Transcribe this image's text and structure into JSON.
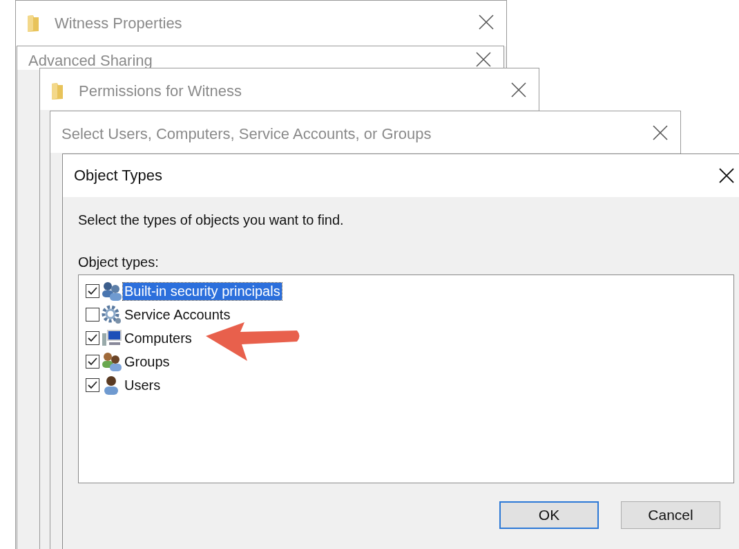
{
  "windows": [
    {
      "title": "Witness Properties",
      "folder_icon": true
    },
    {
      "title": "Advanced Sharing",
      "folder_icon": false
    },
    {
      "title": "Permissions for Witness",
      "folder_icon": true
    },
    {
      "title": "Select Users, Computers, Service Accounts, or Groups",
      "folder_icon": false
    }
  ],
  "dialog": {
    "title": "Object Types",
    "instruction": "Select the types of objects you want to find.",
    "list_label": "Object types:",
    "items": [
      {
        "label": "Built-in security principals",
        "checked": true,
        "selected": true
      },
      {
        "label": "Service Accounts",
        "checked": false,
        "selected": false
      },
      {
        "label": "Computers",
        "checked": true,
        "selected": false
      },
      {
        "label": "Groups",
        "checked": true,
        "selected": false
      },
      {
        "label": "Users",
        "checked": true,
        "selected": false
      }
    ],
    "buttons": [
      {
        "label": "OK",
        "default": true
      },
      {
        "label": "Cancel",
        "default": false
      }
    ]
  }
}
